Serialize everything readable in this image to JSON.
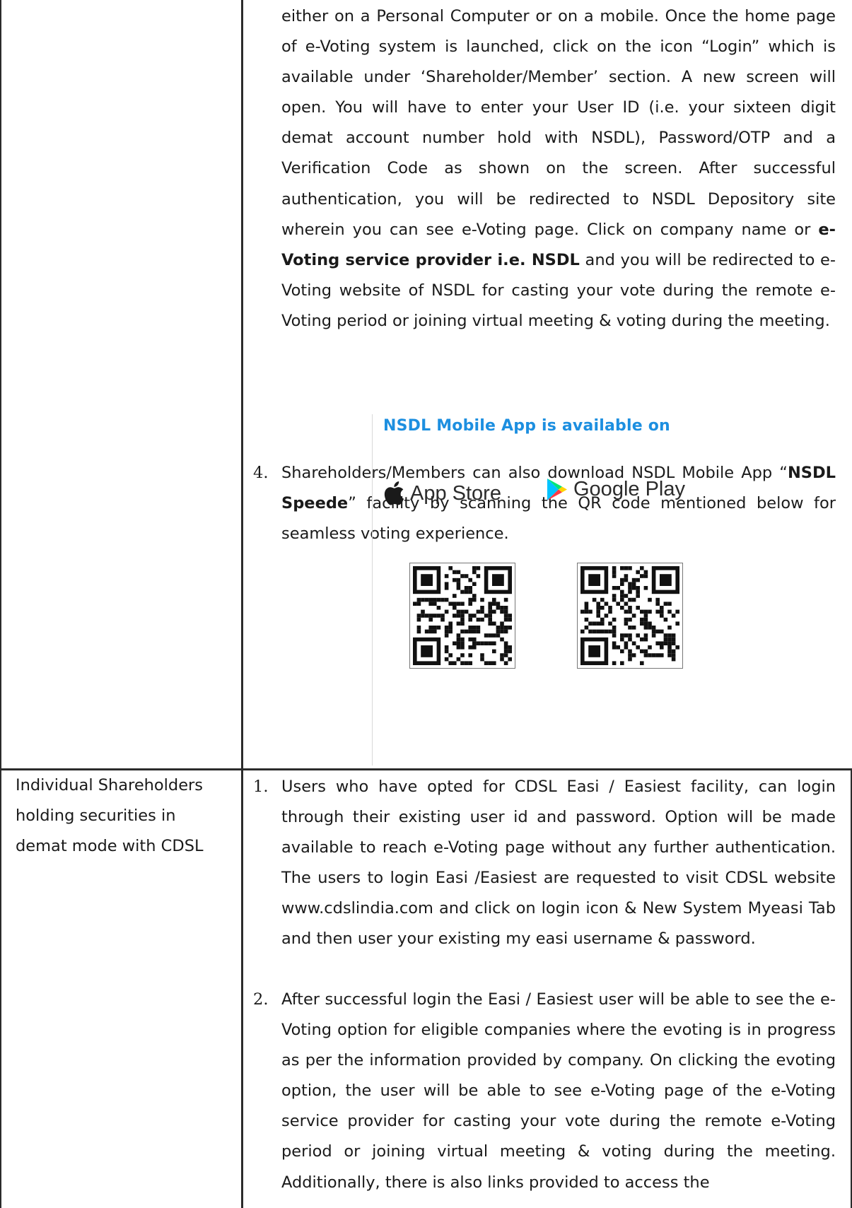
{
  "nsdl_section": {
    "intro_paragraph_html": "either on a Personal Computer or on a mobile. Once the home page of e-Voting system is launched, click on the icon “Login” which is available under ‘Shareholder/Member’ section. A new screen will open. You will have to enter your User ID (i.e. your sixteen digit demat account number hold with NSDL), Password/OTP and a Verification Code as shown on the screen. After successful authentication, you will be redirected to NSDL Depository site wherein you can see e-Voting page. Click on company name or <b>e-Voting service provider i.e. NSDL</b> and you will be redirected to e-Voting website of NSDL for casting your vote during the remote e-Voting period or joining virtual meeting &amp; voting during the meeting.",
    "item4": {
      "number": "4.",
      "text_html": "Shareholders/Members can also download NSDL Mobile App “<b>NSDL Speede</b>” facility by scanning the QR code mentioned below for seamless voting experience."
    },
    "promo": {
      "title": "NSDL Mobile App is available on",
      "app_store_label": "App Store",
      "google_play_label": "Google Play",
      "apple_icon": "apple-logo-icon",
      "google_icon": "google-play-logo-icon",
      "qr_icon": "qr-code-icon",
      "title_color": "#1d8fe0"
    }
  },
  "cdsl_section": {
    "label": "Individual Shareholders holding securities in demat mode with CDSL",
    "item1": {
      "number": "1.",
      "text": "Users who have opted for CDSL Easi / Easiest facility, can login through their existing user id and password. Option will be made available to reach e-Voting page without any further authentication. The users to login Easi /Easiest are requested to visit CDSL website www.cdslindia.com and click on login icon & New System Myeasi Tab and then user your existing my easi username & password."
    },
    "item2": {
      "number": "2.",
      "text": "After successful login the Easi / Easiest user will be able to see the e-Voting option for eligible companies where the evoting is in progress as per the information provided by company. On clicking the evoting option, the user will be able to see e-Voting page of the e-Voting service provider for casting your vote during the remote e-Voting period or joining virtual meeting & voting during the meeting. Additionally, there is also links provided to access the"
    }
  }
}
